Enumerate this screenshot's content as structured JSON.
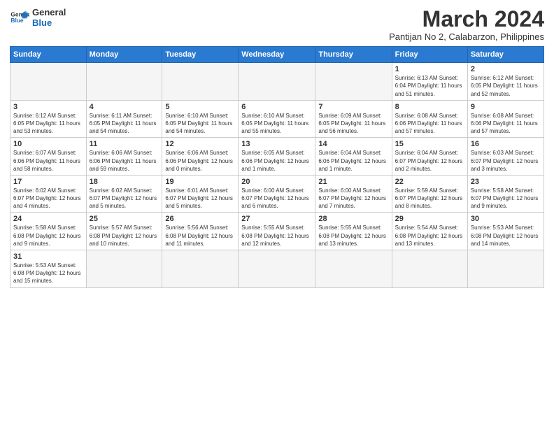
{
  "header": {
    "logo_line1": "General",
    "logo_line2": "Blue",
    "main_title": "March 2024",
    "subtitle": "Pantijan No 2, Calabarzon, Philippines"
  },
  "weekdays": [
    "Sunday",
    "Monday",
    "Tuesday",
    "Wednesday",
    "Thursday",
    "Friday",
    "Saturday"
  ],
  "weeks": [
    [
      {
        "day": "",
        "info": ""
      },
      {
        "day": "",
        "info": ""
      },
      {
        "day": "",
        "info": ""
      },
      {
        "day": "",
        "info": ""
      },
      {
        "day": "",
        "info": ""
      },
      {
        "day": "1",
        "info": "Sunrise: 6:13 AM\nSunset: 6:04 PM\nDaylight: 11 hours and 51 minutes."
      },
      {
        "day": "2",
        "info": "Sunrise: 6:12 AM\nSunset: 6:05 PM\nDaylight: 11 hours and 52 minutes."
      }
    ],
    [
      {
        "day": "3",
        "info": "Sunrise: 6:12 AM\nSunset: 6:05 PM\nDaylight: 11 hours and 53 minutes."
      },
      {
        "day": "4",
        "info": "Sunrise: 6:11 AM\nSunset: 6:05 PM\nDaylight: 11 hours and 54 minutes."
      },
      {
        "day": "5",
        "info": "Sunrise: 6:10 AM\nSunset: 6:05 PM\nDaylight: 11 hours and 54 minutes."
      },
      {
        "day": "6",
        "info": "Sunrise: 6:10 AM\nSunset: 6:05 PM\nDaylight: 11 hours and 55 minutes."
      },
      {
        "day": "7",
        "info": "Sunrise: 6:09 AM\nSunset: 6:05 PM\nDaylight: 11 hours and 56 minutes."
      },
      {
        "day": "8",
        "info": "Sunrise: 6:08 AM\nSunset: 6:06 PM\nDaylight: 11 hours and 57 minutes."
      },
      {
        "day": "9",
        "info": "Sunrise: 6:08 AM\nSunset: 6:06 PM\nDaylight: 11 hours and 57 minutes."
      }
    ],
    [
      {
        "day": "10",
        "info": "Sunrise: 6:07 AM\nSunset: 6:06 PM\nDaylight: 11 hours and 58 minutes."
      },
      {
        "day": "11",
        "info": "Sunrise: 6:06 AM\nSunset: 6:06 PM\nDaylight: 11 hours and 59 minutes."
      },
      {
        "day": "12",
        "info": "Sunrise: 6:06 AM\nSunset: 6:06 PM\nDaylight: 12 hours and 0 minutes."
      },
      {
        "day": "13",
        "info": "Sunrise: 6:05 AM\nSunset: 6:06 PM\nDaylight: 12 hours and 1 minute."
      },
      {
        "day": "14",
        "info": "Sunrise: 6:04 AM\nSunset: 6:06 PM\nDaylight: 12 hours and 1 minute."
      },
      {
        "day": "15",
        "info": "Sunrise: 6:04 AM\nSunset: 6:07 PM\nDaylight: 12 hours and 2 minutes."
      },
      {
        "day": "16",
        "info": "Sunrise: 6:03 AM\nSunset: 6:07 PM\nDaylight: 12 hours and 3 minutes."
      }
    ],
    [
      {
        "day": "17",
        "info": "Sunrise: 6:02 AM\nSunset: 6:07 PM\nDaylight: 12 hours and 4 minutes."
      },
      {
        "day": "18",
        "info": "Sunrise: 6:02 AM\nSunset: 6:07 PM\nDaylight: 12 hours and 5 minutes."
      },
      {
        "day": "19",
        "info": "Sunrise: 6:01 AM\nSunset: 6:07 PM\nDaylight: 12 hours and 5 minutes."
      },
      {
        "day": "20",
        "info": "Sunrise: 6:00 AM\nSunset: 6:07 PM\nDaylight: 12 hours and 6 minutes."
      },
      {
        "day": "21",
        "info": "Sunrise: 6:00 AM\nSunset: 6:07 PM\nDaylight: 12 hours and 7 minutes."
      },
      {
        "day": "22",
        "info": "Sunrise: 5:59 AM\nSunset: 6:07 PM\nDaylight: 12 hours and 8 minutes."
      },
      {
        "day": "23",
        "info": "Sunrise: 5:58 AM\nSunset: 6:07 PM\nDaylight: 12 hours and 9 minutes."
      }
    ],
    [
      {
        "day": "24",
        "info": "Sunrise: 5:58 AM\nSunset: 6:08 PM\nDaylight: 12 hours and 9 minutes."
      },
      {
        "day": "25",
        "info": "Sunrise: 5:57 AM\nSunset: 6:08 PM\nDaylight: 12 hours and 10 minutes."
      },
      {
        "day": "26",
        "info": "Sunrise: 5:56 AM\nSunset: 6:08 PM\nDaylight: 12 hours and 11 minutes."
      },
      {
        "day": "27",
        "info": "Sunrise: 5:55 AM\nSunset: 6:08 PM\nDaylight: 12 hours and 12 minutes."
      },
      {
        "day": "28",
        "info": "Sunrise: 5:55 AM\nSunset: 6:08 PM\nDaylight: 12 hours and 13 minutes."
      },
      {
        "day": "29",
        "info": "Sunrise: 5:54 AM\nSunset: 6:08 PM\nDaylight: 12 hours and 13 minutes."
      },
      {
        "day": "30",
        "info": "Sunrise: 5:53 AM\nSunset: 6:08 PM\nDaylight: 12 hours and 14 minutes."
      }
    ],
    [
      {
        "day": "31",
        "info": "Sunrise: 5:53 AM\nSunset: 6:08 PM\nDaylight: 12 hours and 15 minutes."
      },
      {
        "day": "",
        "info": ""
      },
      {
        "day": "",
        "info": ""
      },
      {
        "day": "",
        "info": ""
      },
      {
        "day": "",
        "info": ""
      },
      {
        "day": "",
        "info": ""
      },
      {
        "day": "",
        "info": ""
      }
    ]
  ]
}
